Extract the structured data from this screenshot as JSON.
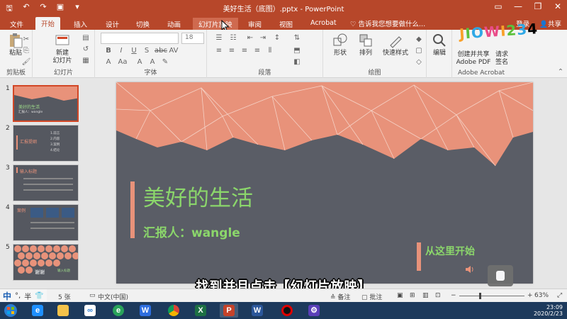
{
  "window": {
    "title": "美好生活（底图）.pptx - PowerPoint",
    "controls": [
      "minimize",
      "restore",
      "close"
    ]
  },
  "quick_access": {
    "icons": [
      "save-icon",
      "undo-icon",
      "redo-icon",
      "start-slideshow-icon",
      "customize-icon"
    ]
  },
  "tabs": [
    {
      "label": "文件",
      "state": "normal"
    },
    {
      "label": "开始",
      "state": "active"
    },
    {
      "label": "插入",
      "state": "normal"
    },
    {
      "label": "设计",
      "state": "normal"
    },
    {
      "label": "切换",
      "state": "normal"
    },
    {
      "label": "动画",
      "state": "normal"
    },
    {
      "label": "幻灯片放映",
      "state": "hover"
    },
    {
      "label": "审阅",
      "state": "normal"
    },
    {
      "label": "视图",
      "state": "normal"
    },
    {
      "label": "Acrobat",
      "state": "normal"
    }
  ],
  "tell_me": "♡ 告诉我您想要做什么...",
  "account": {
    "login": "登录",
    "share": "共享"
  },
  "ribbon": {
    "clipboard": {
      "paste": "粘贴",
      "label": "剪贴板"
    },
    "slides": {
      "new_slide_line1": "新建",
      "new_slide_line2": "幻灯片",
      "label": "幻灯片"
    },
    "font": {
      "size": "18",
      "label": "字体"
    },
    "paragraph": {
      "label": "段落"
    },
    "drawing": {
      "shapes": "形状",
      "arrange": "排列",
      "quick_styles": "快速样式",
      "label": "绘图"
    },
    "editing": {
      "edit": "编辑"
    },
    "acrobat": {
      "create_share_line1": "创建并共享",
      "create_share_line2": "Adobe PDF",
      "request_line1": "请求",
      "request_line2": "签名",
      "label": "Adobe Acrobat"
    }
  },
  "logo": {
    "text": "JIOWI234"
  },
  "thumbnails": [
    {
      "number": "1",
      "title": "美好的生活",
      "subtitle": "汇报人：wangle",
      "selected": true
    },
    {
      "number": "2",
      "title": "汇报提纲",
      "items": [
        "1.前言",
        "2.内容",
        "3.案例",
        "4.结论"
      ],
      "selected": false
    },
    {
      "number": "3",
      "title": "输入标题",
      "selected": false
    },
    {
      "number": "4",
      "title": "案例",
      "selected": false
    },
    {
      "number": "5",
      "title": "谢谢",
      "subtitle": "输入标题",
      "selected": false
    }
  ],
  "slide": {
    "title": "美好的生活",
    "reporter": "汇报人：wangle",
    "start_text": "从这里开始",
    "colors": {
      "background": "#5a5d66",
      "polygon": "#e8927a",
      "text": "#8bd66b"
    }
  },
  "caption": "找到并且点击【幻灯片放映】",
  "ime": {
    "mode": "中",
    "punct": "°,",
    "width": "半"
  },
  "statusbar": {
    "slide_count": "5 张",
    "language": "中文(中国)",
    "notes": "备注",
    "comments": "批注",
    "zoom": "63%",
    "zoom_level": 0.63
  },
  "taskbar": {
    "apps": [
      "start-icon",
      "ie-icon",
      "file-explorer-icon",
      "baidu-netdisk-icon",
      "edge-icon",
      "wps-icon",
      "chrome-icon",
      "excel-icon",
      "powerpoint-icon",
      "word-icon",
      "recorder-icon",
      "settings-icon"
    ],
    "time": "23:09",
    "date": "2020/2/23"
  }
}
